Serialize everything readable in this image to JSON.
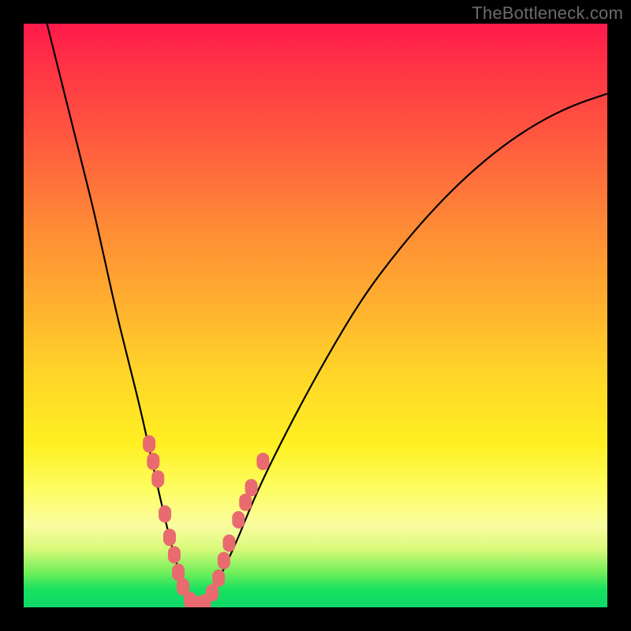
{
  "watermark": "TheBottleneck.com",
  "chart_data": {
    "type": "line",
    "title": "",
    "xlabel": "",
    "ylabel": "",
    "xlim": [
      0,
      100
    ],
    "ylim": [
      0,
      100
    ],
    "grid": false,
    "legend": false,
    "series": [
      {
        "name": "bottleneck-curve",
        "color": "#000000",
        "x": [
          4,
          6,
          8,
          10,
          12,
          14,
          16,
          18,
          20,
          22,
          24,
          26,
          28,
          30,
          32,
          36,
          40,
          46,
          52,
          58,
          64,
          70,
          76,
          82,
          88,
          94,
          100
        ],
        "y": [
          100,
          92,
          84,
          76,
          68,
          59,
          50,
          42,
          34,
          25,
          16,
          8,
          2,
          0,
          2,
          10,
          20,
          32,
          43,
          53,
          61,
          68,
          74,
          79,
          83,
          86,
          88
        ]
      }
    ],
    "markers": {
      "name": "highlighted-points",
      "color": "#e96a6f",
      "shape": "rounded-rect",
      "points": [
        {
          "x": 21.5,
          "y": 28
        },
        {
          "x": 22.2,
          "y": 25
        },
        {
          "x": 23.0,
          "y": 22
        },
        {
          "x": 24.2,
          "y": 16
        },
        {
          "x": 25.0,
          "y": 12
        },
        {
          "x": 25.8,
          "y": 9
        },
        {
          "x": 26.5,
          "y": 6
        },
        {
          "x": 27.3,
          "y": 3.5
        },
        {
          "x": 28.5,
          "y": 1.2
        },
        {
          "x": 29.6,
          "y": 0.5
        },
        {
          "x": 31.0,
          "y": 0.8
        },
        {
          "x": 32.3,
          "y": 2.5
        },
        {
          "x": 33.4,
          "y": 5
        },
        {
          "x": 34.3,
          "y": 8
        },
        {
          "x": 35.2,
          "y": 11
        },
        {
          "x": 36.8,
          "y": 15
        },
        {
          "x": 38.0,
          "y": 18
        },
        {
          "x": 39.0,
          "y": 20.5
        },
        {
          "x": 41.0,
          "y": 25
        }
      ]
    },
    "background_gradient_stops": [
      {
        "pos": 0.0,
        "color": "#ff1a4b"
      },
      {
        "pos": 0.34,
        "color": "#ff8836"
      },
      {
        "pos": 0.72,
        "color": "#fff022"
      },
      {
        "pos": 0.9,
        "color": "#d9f97a"
      },
      {
        "pos": 1.0,
        "color": "#0fd868"
      }
    ]
  }
}
